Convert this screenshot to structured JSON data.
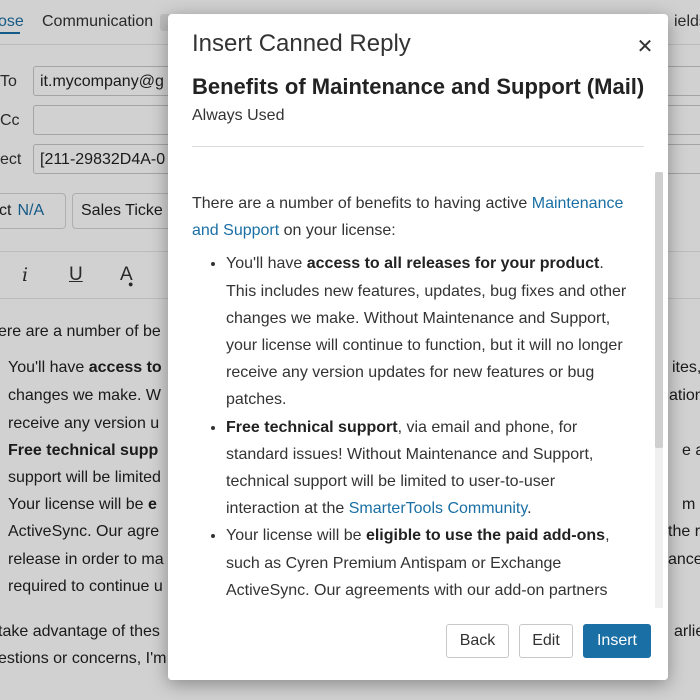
{
  "background": {
    "tabs": [
      {
        "label": "ose",
        "active": true
      },
      {
        "label": "Communication"
      },
      {
        "label": "ields"
      }
    ],
    "fields": {
      "to_label": "To",
      "to_value": "it.mycompany@g",
      "cc_label": "Cc",
      "cc_value": "",
      "subject_label": "ect",
      "subject_value": "[211-29832D4A-0"
    },
    "product_label": "ct",
    "product_value": "N/A",
    "ticket_label": "Sales Ticke",
    "toolbar": {
      "italic": "i",
      "underline": "U",
      "font_color": "A"
    },
    "body_lines": [
      "ere are a number of be",
      "You'll have ",
      "access to",
      "changes we make. W",
      "receive any version u",
      "Free technical supp",
      "support will be limited",
      "Your license will be ",
      "e",
      "ActiveSync. Our agre",
      "release in order to ma",
      "required to continue u",
      "take advantage of thes",
      "estions or concerns, I'm"
    ],
    "right_fragments": [
      "ites, ",
      "ation,",
      "e an",
      "m or",
      "the r",
      "ance",
      "arliest"
    ]
  },
  "modal": {
    "title": "Insert Canned Reply",
    "reply_name": "Benefits of Maintenance and Support (Mail)",
    "reply_subtitle": "Always Used",
    "intro_1": "There are a number of benefits to having active ",
    "intro_link": "Maintenance and Support",
    "intro_2": " on your license:",
    "bullets": [
      {
        "pre": "You'll have ",
        "bold": "access to all releases for your product",
        "post": ". This includes new features, updates, bug fixes and other changes we make. Without Maintenance and Support, your license will continue to function, but it will no longer receive any version updates for new features or bug patches."
      },
      {
        "pre": "",
        "bold": "Free technical support",
        "post": ", via email and phone, for standard issues! Without Maintenance and Support, technical support will be limited to user-to-user interaction at the ",
        "link": "SmarterTools Community",
        "post2": "."
      },
      {
        "pre": "Your license will be ",
        "bold": "eligible to use the paid add-ons",
        "post": ", such as Cyren Premium Antispam or Exchange ActiveSync. Our agreements with our add-on partners"
      }
    ],
    "buttons": {
      "back": "Back",
      "edit": "Edit",
      "insert": "Insert"
    }
  },
  "colors": {
    "accent": "#1a6fa5",
    "overlay": "rgba(0,0,0,0.18)"
  }
}
